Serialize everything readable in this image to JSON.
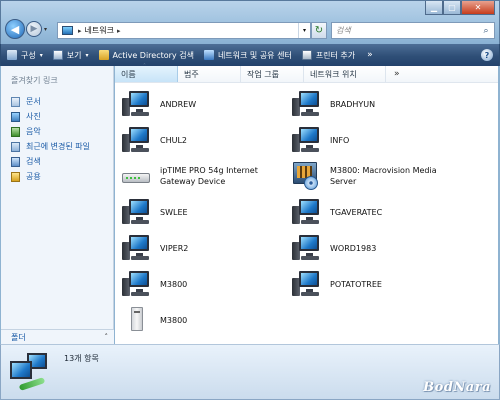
{
  "window": {
    "minimize_glyph": "▁",
    "maximize_glyph": "▢",
    "close_glyph": "✕"
  },
  "address_bar": {
    "back_glyph": "◀",
    "forward_glyph": "▶",
    "dropdown_glyph": "▾",
    "crumb": "네트워크",
    "crumb_separator": "▸",
    "refresh_glyph": "↻"
  },
  "search": {
    "placeholder": "검색",
    "icon": "search-icon",
    "icon_glyph": "⌕"
  },
  "command_bar": {
    "organize": "구성",
    "views": "보기",
    "active_directory_search": "Active Directory 검색",
    "network_sharing_center": "네트워크 및 공유 센터",
    "add_printer": "프린터 추가",
    "more_glyph": "»",
    "dropdown_glyph": "▾",
    "help_glyph": "?"
  },
  "nav_pane": {
    "favorites_title": "즐겨찾기 링크",
    "items": [
      {
        "label": "문서",
        "icon": "documents-icon"
      },
      {
        "label": "사진",
        "icon": "pictures-icon"
      },
      {
        "label": "음악",
        "icon": "music-icon"
      },
      {
        "label": "최근에 변경된 파일",
        "icon": "recent-icon"
      },
      {
        "label": "검색",
        "icon": "searches-icon"
      },
      {
        "label": "공용",
        "icon": "public-icon"
      }
    ],
    "folders_label": "폴더",
    "folders_toggle_glyph": "˄"
  },
  "columns": {
    "name": "이름",
    "category": "범주",
    "workgroup": "작업 그룹",
    "network_location": "네트워크 위치",
    "more_glyph": "»",
    "sort_glyph": "˄"
  },
  "items": [
    {
      "name": "ANDREW",
      "type": "computer"
    },
    {
      "name": "BRADHYUN",
      "type": "computer"
    },
    {
      "name": "CHUL2",
      "type": "computer"
    },
    {
      "name": "INFO",
      "type": "computer"
    },
    {
      "name_line1": "ipTIME PRO 54g Internet",
      "name_line2": "Gateway Device",
      "type": "router"
    },
    {
      "name_line1": "M3800: Macrovision Media",
      "name_line2": "Server",
      "type": "media-server"
    },
    {
      "name": "SWLEE",
      "type": "computer"
    },
    {
      "name": "TGAVERATEC",
      "type": "computer"
    },
    {
      "name": "VIPER2",
      "type": "computer"
    },
    {
      "name": "WORD1983",
      "type": "computer"
    },
    {
      "name": "M3800",
      "type": "computer"
    },
    {
      "name": "POTATOTREE",
      "type": "computer"
    },
    {
      "name": "M3800",
      "type": "device"
    }
  ],
  "details": {
    "count": "13개 항목",
    "watermark": "BodNara"
  }
}
